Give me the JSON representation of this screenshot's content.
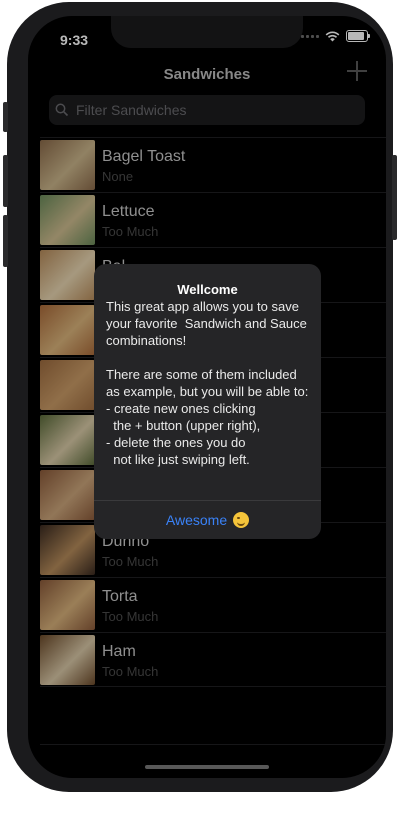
{
  "status_bar": {
    "time": "9:33"
  },
  "nav": {
    "title": "Sandwiches"
  },
  "search": {
    "placeholder": "Filter Sandwiches",
    "value": ""
  },
  "sandwiches": [
    {
      "name": "Bagel Toast",
      "sauce": "None",
      "colors": [
        "#8a6a4a",
        "#c9b48a"
      ]
    },
    {
      "name": "Lettuce",
      "sauce": "Too Much",
      "colors": [
        "#6a8a5a",
        "#cdbb8e"
      ]
    },
    {
      "name": "Bal...",
      "sauce": "",
      "colors": [
        "#b58a5a",
        "#e6d4b0"
      ]
    },
    {
      "name": "",
      "sauce": "",
      "colors": [
        "#a96a3a",
        "#d8b27a"
      ]
    },
    {
      "name": "",
      "sauce": "",
      "colors": [
        "#9c6b3f",
        "#c89a66"
      ]
    },
    {
      "name": "",
      "sauce": "",
      "colors": [
        "#5a6a3a",
        "#d8c9a6"
      ]
    },
    {
      "name": "",
      "sauce": "",
      "colors": [
        "#8a5a3a",
        "#caa47a"
      ]
    },
    {
      "name": "Dunno",
      "sauce": "Too Much",
      "colors": [
        "#3a2a20",
        "#b48a5a"
      ]
    },
    {
      "name": "Torta",
      "sauce": "Too Much",
      "colors": [
        "#8a5a3a",
        "#d6b07a"
      ]
    },
    {
      "name": "Ham",
      "sauce": "Too Much",
      "colors": [
        "#6b4a2a",
        "#d8c7a6"
      ]
    }
  ],
  "alert": {
    "title": "Wellcome",
    "body": "This great app allows you to save your favorite  Sandwich and Sauce combinations!\n\nThere are some of them included as example, but you will be able to:\n- create new ones clicking\n  the + button (upper right),\n- delete the ones you do\n  not like just swiping left.",
    "button_label": "Awesome",
    "button_icon": "smirk-emoji-icon"
  }
}
